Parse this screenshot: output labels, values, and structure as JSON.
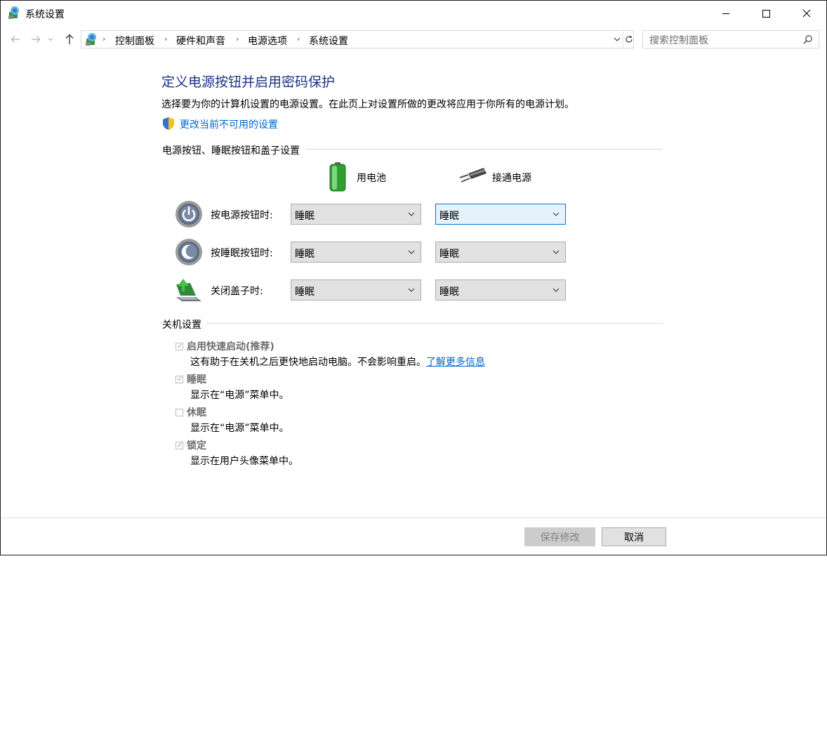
{
  "window": {
    "title": "系统设置"
  },
  "titlebar": {
    "minimize_icon": "minimize-icon",
    "maximize_icon": "maximize-icon",
    "close_icon": "close-icon"
  },
  "nav": {
    "breadcrumbs": [
      "控制面板",
      "硬件和声音",
      "电源选项",
      "系统设置"
    ],
    "search_placeholder": "搜索控制面板"
  },
  "page": {
    "heading": "定义电源按钮并启用密码保护",
    "description": "选择要为你的计算机设置的电源设置。在此页上对设置所做的更改将应用于你所有的电源计划。",
    "change_link": "更改当前不可用的设置"
  },
  "buttons_section": {
    "title": "电源按钮、睡眠按钮和盖子设置",
    "columns": [
      "用电池",
      "接通电源"
    ],
    "rows": [
      {
        "label": "按电源按钮时:",
        "icon": "power-button-icon",
        "battery": "睡眠",
        "plugged": "睡眠"
      },
      {
        "label": "按睡眠按钮时:",
        "icon": "sleep-button-icon",
        "battery": "睡眠",
        "plugged": "睡眠"
      },
      {
        "label": "关闭盖子时:",
        "icon": "lid-close-icon",
        "battery": "睡眠",
        "plugged": "睡眠"
      }
    ]
  },
  "shutdown_section": {
    "title": "关机设置",
    "options": [
      {
        "label": "启用快速启动(推荐)",
        "checked": true,
        "desc": "这有助于在关机之后更快地启动电脑。不会影响重启。",
        "link": "了解更多信息"
      },
      {
        "label": "睡眠",
        "checked": true,
        "desc": "显示在“电源”菜单中。"
      },
      {
        "label": "休眠",
        "checked": false,
        "desc": "显示在“电源”菜单中。"
      },
      {
        "label": "锁定",
        "checked": true,
        "desc": "显示在用户头像菜单中。"
      }
    ]
  },
  "footer": {
    "save_label": "保存修改",
    "cancel_label": "取消"
  },
  "colors": {
    "heading": "#1e3287",
    "link": "#0066cc",
    "accent": "#0078d7"
  }
}
